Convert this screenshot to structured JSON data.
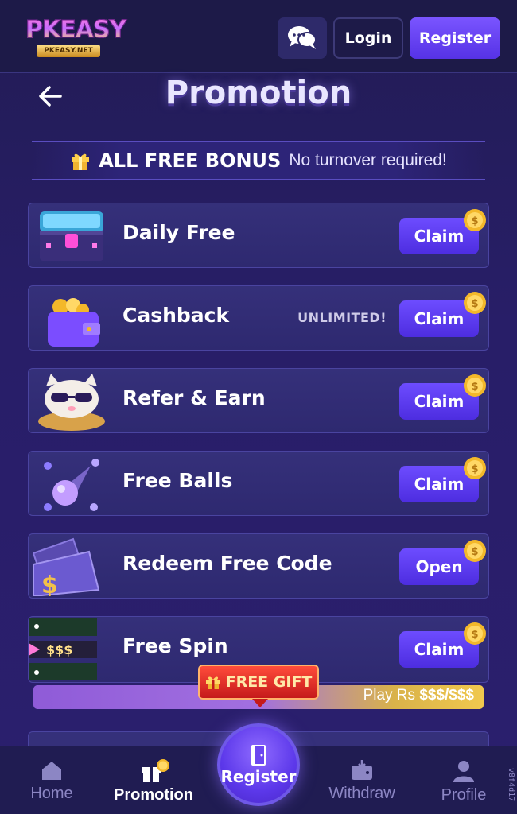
{
  "header": {
    "logo_text": "PKEASY",
    "logo_sub": "PKEASY.NET",
    "login_label": "Login",
    "register_label": "Register"
  },
  "page": {
    "title": "Promotion"
  },
  "banner": {
    "title": "ALL FREE BONUS",
    "subtitle": "No turnover required!"
  },
  "promos": [
    {
      "label": "Daily Free",
      "button": "Claim",
      "tag": ""
    },
    {
      "label": "Cashback",
      "button": "Claim",
      "tag": "UNLIMITED!"
    },
    {
      "label": "Refer & Earn",
      "button": "Claim",
      "tag": ""
    },
    {
      "label": "Free Balls",
      "button": "Claim",
      "tag": ""
    },
    {
      "label": "Redeem Free Code",
      "button": "Open",
      "tag": ""
    },
    {
      "label": "Free Spin",
      "button": "Claim",
      "tag": ""
    }
  ],
  "spin": {
    "strip_text": "$$$",
    "progress_prefix": "Play Rs ",
    "progress_amount": "$$$/$$$"
  },
  "free_gift": {
    "label": "FREE GIFT"
  },
  "bottom_nav": {
    "home": "Home",
    "promotion": "Promotion",
    "register": "Register",
    "withdraw": "Withdraw",
    "profile": "Profile"
  },
  "watermark": "v8f4d17",
  "colors": {
    "accent": "#5632e6",
    "background": "#281e68",
    "card": "#35307a",
    "gold": "#f0c84e",
    "gift_red": "#c51a1a"
  }
}
